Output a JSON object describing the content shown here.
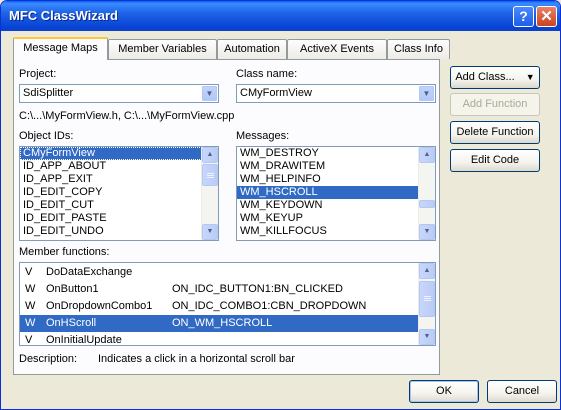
{
  "window": {
    "title": "MFC ClassWizard",
    "help_glyph": "?",
    "close_glyph": "✕"
  },
  "tabs": [
    "Message Maps",
    "Member Variables",
    "Automation",
    "ActiveX Events",
    "Class Info"
  ],
  "project": {
    "label": "Project:",
    "value": "SdiSplitter"
  },
  "class_name": {
    "label": "Class name:",
    "value": "CMyFormView"
  },
  "file_path": "C:\\...\\MyFormView.h, C:\\...\\MyFormView.cpp",
  "object_ids": {
    "label": "Object IDs:",
    "items": [
      "CMyFormView",
      "ID_APP_ABOUT",
      "ID_APP_EXIT",
      "ID_EDIT_COPY",
      "ID_EDIT_CUT",
      "ID_EDIT_PASTE",
      "ID_EDIT_UNDO"
    ],
    "selected_index": 0
  },
  "messages": {
    "label": "Messages:",
    "items": [
      "WM_DESTROY",
      "WM_DRAWITEM",
      "WM_HELPINFO",
      "WM_HSCROLL",
      "WM_KEYDOWN",
      "WM_KEYUP",
      "WM_KILLFOCUS"
    ],
    "selected_index": 3
  },
  "member_functions": {
    "label": "Member functions:",
    "rows": [
      {
        "v": "V",
        "name": "DoDataExchange",
        "event": ""
      },
      {
        "v": "W",
        "name": "OnButton1",
        "event": "ON_IDC_BUTTON1:BN_CLICKED"
      },
      {
        "v": "W",
        "name": "OnDropdownCombo1",
        "event": "ON_IDC_COMBO1:CBN_DROPDOWN"
      },
      {
        "v": "W",
        "name": "OnHScroll",
        "event": "ON_WM_HSCROLL"
      },
      {
        "v": "V",
        "name": "OnInitialUpdate",
        "event": ""
      }
    ],
    "selected_index": 3
  },
  "description": {
    "label": "Description:",
    "text": "Indicates a click in a horizontal scroll bar"
  },
  "buttons": {
    "add_class": "Add Class...",
    "add_function": "Add Function",
    "delete_function": "Delete Function",
    "edit_code": "Edit Code",
    "ok": "OK",
    "cancel": "Cancel"
  }
}
